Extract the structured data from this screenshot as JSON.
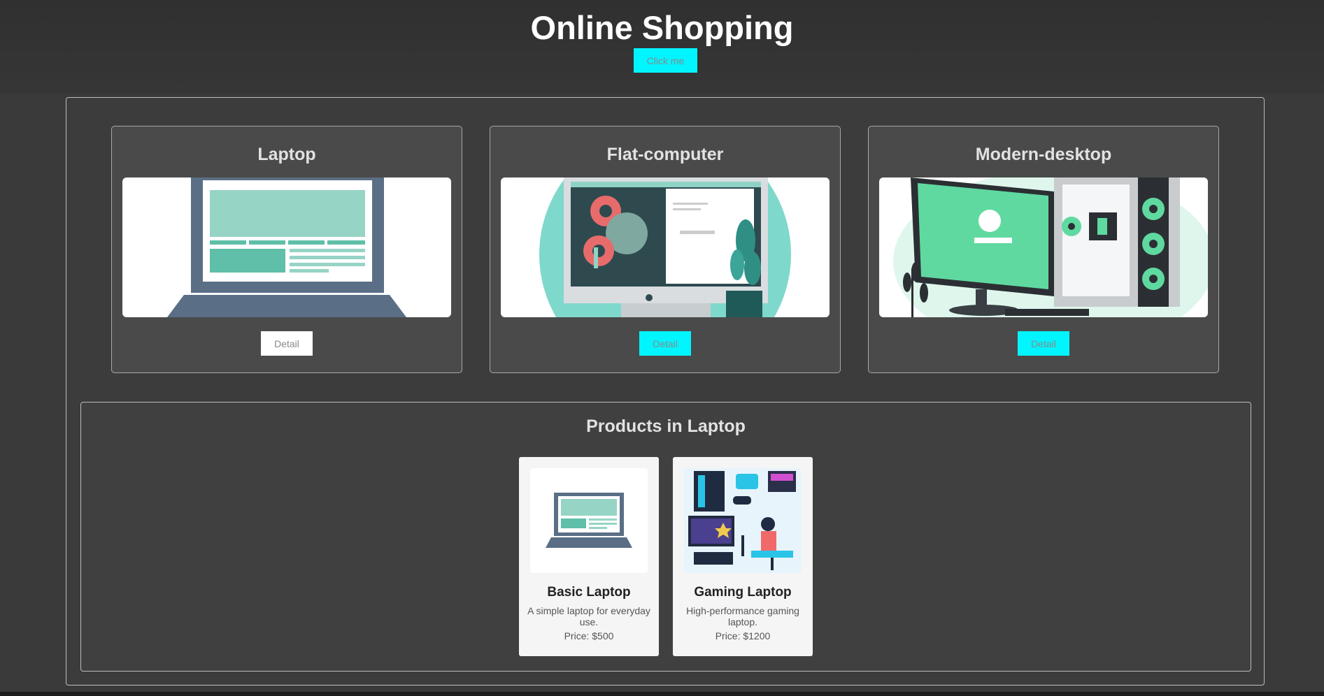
{
  "header": {
    "title": "Online Shopping",
    "click_button": "Click me"
  },
  "categories": [
    {
      "title": "Laptop",
      "detail_label": "Detail",
      "image_icon": "laptop-illustration",
      "selected": true
    },
    {
      "title": "Flat-computer",
      "detail_label": "Detail",
      "image_icon": "flat-computer-illustration",
      "selected": false
    },
    {
      "title": "Modern-desktop",
      "detail_label": "Detail",
      "image_icon": "modern-desktop-illustration",
      "selected": false
    }
  ],
  "products_section": {
    "title": "Products in Laptop",
    "items": [
      {
        "name": "Basic Laptop",
        "description": "A simple laptop for everyday use.",
        "price": "Price: $500",
        "image_icon": "basic-laptop-illustration"
      },
      {
        "name": "Gaming Laptop",
        "description": "High-performance gaming laptop.",
        "price": "Price: $1200",
        "image_icon": "gaming-setup-illustration"
      }
    ]
  },
  "colors": {
    "accent": "#00f5ff",
    "background": "#3a3a3a",
    "card": "#4a4a4a",
    "illustration_primary": "#5a6f85",
    "illustration_teal": "#8fd3c4"
  }
}
